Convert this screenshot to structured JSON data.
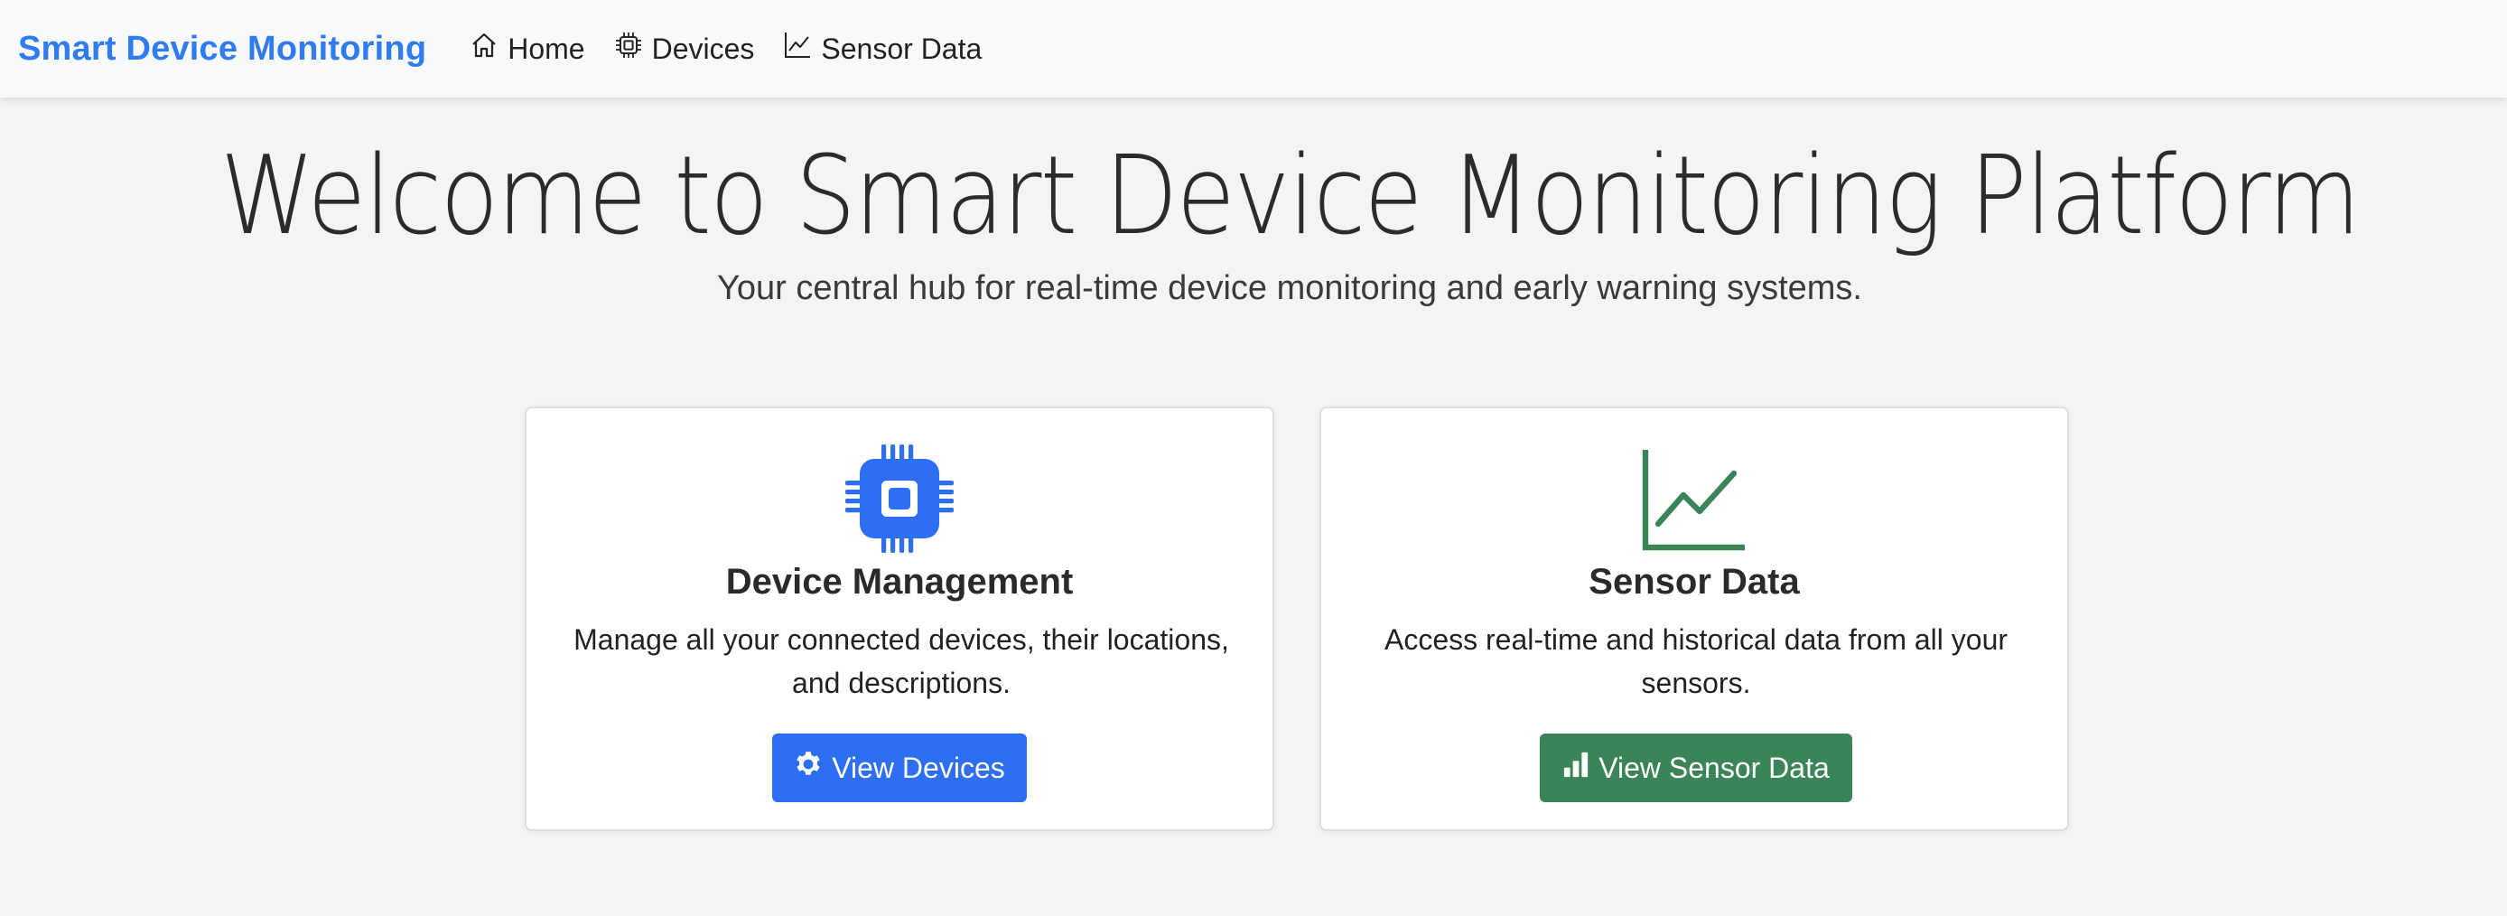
{
  "navbar": {
    "brand": "Smart Device Monitoring",
    "links": [
      {
        "label": "Home",
        "icon": "home-icon"
      },
      {
        "label": "Devices",
        "icon": "cpu-icon"
      },
      {
        "label": "Sensor Data",
        "icon": "graph-icon"
      }
    ]
  },
  "hero": {
    "title": "Welcome to Smart Device Monitoring Platform",
    "subtitle": "Your central hub for real-time device monitoring and early warning systems."
  },
  "cards": [
    {
      "icon": "cpu-icon",
      "title": "Device Management",
      "text": "Manage all your connected devices, their locations, and descriptions.",
      "button_label": "View Devices",
      "button_icon": "gear-icon",
      "accent": "#2e6ff2"
    },
    {
      "icon": "line-chart-icon",
      "title": "Sensor Data",
      "text": "Access real-time and historical data from all your sensors.",
      "button_label": "View Sensor Data",
      "button_icon": "bar-chart-icon",
      "accent": "#3b8457"
    }
  ],
  "colors": {
    "brand": "#2f7bf0",
    "primary": "#2e6ff2",
    "success": "#3b8457",
    "background": "#f3f4f3",
    "navbar": "#f8f9fa"
  }
}
